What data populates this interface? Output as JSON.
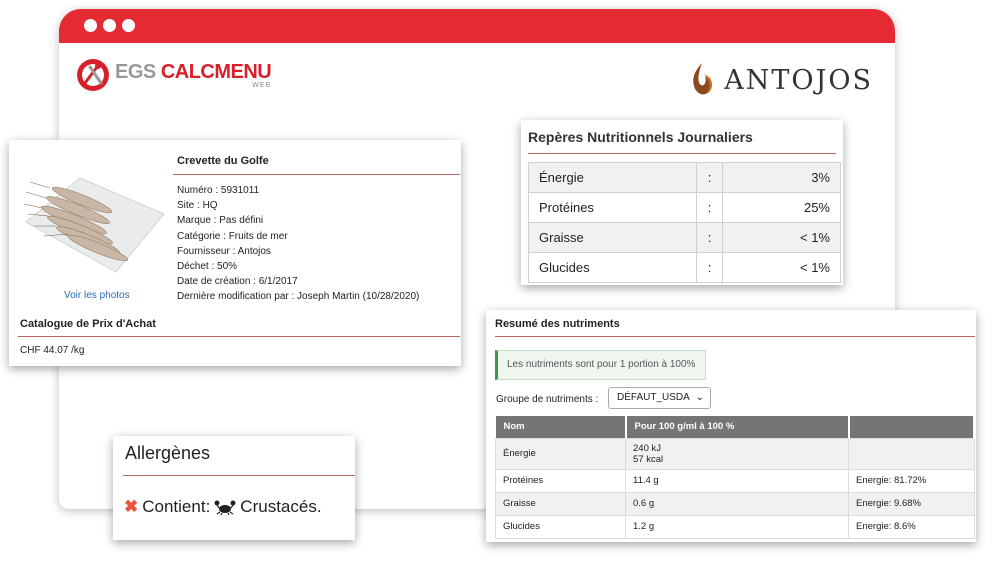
{
  "brand": {
    "egs_part1": "EGS",
    "egs_part2": "CALCMENU",
    "egs_sub": "WEB",
    "client": "ANTOJOS"
  },
  "product": {
    "name": "Crevette du Golfe",
    "info": [
      "Numéro : 5931011",
      "Site : HQ",
      "Marque : Pas défini",
      "Catégorie : Fruits de mer",
      "Fournisseur : Antojos",
      "Déchet : 50%",
      "Date de création : 6/1/2017",
      "Dernière modification par : Joseph Martin (10/28/2020)"
    ],
    "view_photos": "Voir les photos",
    "catalogue_title": "Catalogue de Prix d'Achat",
    "price": "CHF 44.07 /kg"
  },
  "daily": {
    "title": "Repères Nutritionnels Journaliers",
    "rows": [
      {
        "label": "Énergie",
        "sep": ":",
        "value": "3%"
      },
      {
        "label": "Protéines",
        "sep": ":",
        "value": "25%"
      },
      {
        "label": "Graisse",
        "sep": ":",
        "value": "< 1%"
      },
      {
        "label": "Glucides",
        "sep": ":",
        "value": "< 1%"
      }
    ]
  },
  "summary": {
    "title": "Resumé des nutriments",
    "alert": "Les nutriments sont pour 1 portion à 100%",
    "group_label": "Groupe de nutriments :",
    "group_value": "DÉFAUT_USDA",
    "headers": [
      "Nom",
      "Pour 100 g/ml à 100 %",
      ""
    ],
    "rows": [
      {
        "name": "Énergie",
        "value": "240 kJ",
        "value2": "57 kcal",
        "note": ""
      },
      {
        "name": "Protéines",
        "value": "11.4 g",
        "note": "Energie: 81.72%"
      },
      {
        "name": "Graisse",
        "value": "0.6 g",
        "note": "Energie: 9.68%"
      },
      {
        "name": "Glucides",
        "value": "1.2 g",
        "note": "Energie: 8.6%"
      }
    ]
  },
  "allergen": {
    "title": "Allergènes",
    "contains_label": "Contient:",
    "allergen_name": "Crustacés."
  },
  "colors": {
    "brand_red": "#e52a34",
    "header_gray": "#757575",
    "success_green": "#3a9a4c"
  }
}
